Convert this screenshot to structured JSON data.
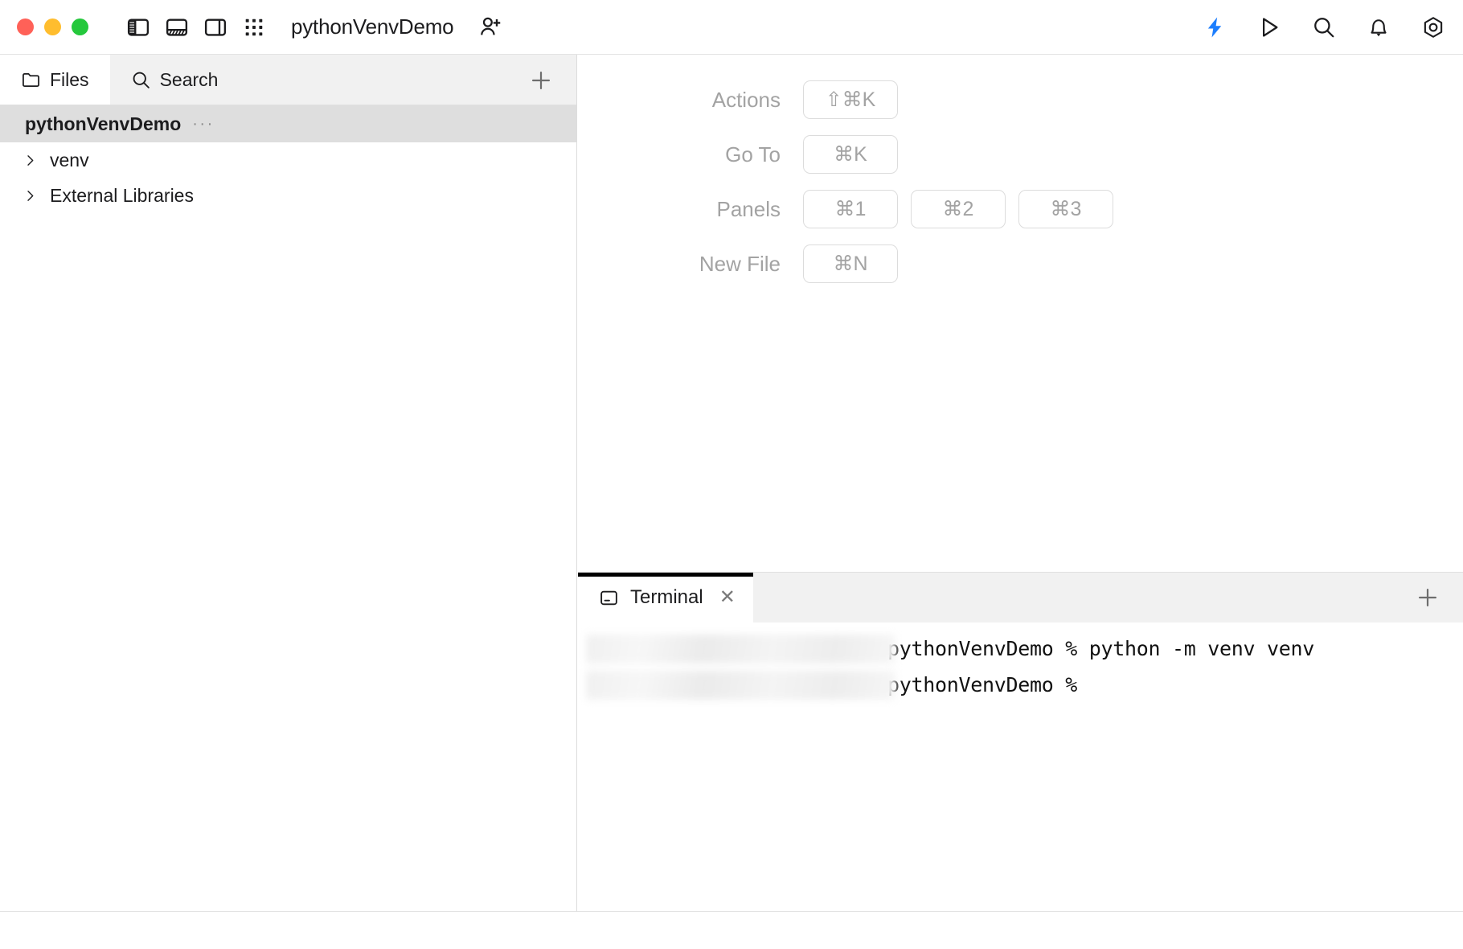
{
  "window": {
    "title": "pythonVenvDemo",
    "traffic_lights": [
      {
        "name": "close",
        "color": "#ff6158"
      },
      {
        "name": "minimize",
        "color": "#ffbd2e"
      },
      {
        "name": "maximize",
        "color": "#25c83c"
      }
    ]
  },
  "toolbar": {
    "left_icons": [
      {
        "name": "toggle-left-panel-icon",
        "label": "Toggle Left Panel"
      },
      {
        "name": "toggle-bottom-panel-icon",
        "label": "Toggle Bottom Panel"
      },
      {
        "name": "toggle-right-panel-icon",
        "label": "Toggle Right Panel"
      },
      {
        "name": "apps-grid-icon",
        "label": "Apps"
      }
    ],
    "share_icon": "add-person-icon",
    "right_icons": [
      {
        "name": "lightning-icon",
        "label": "Assistant",
        "color": "#1d7efd"
      },
      {
        "name": "run-icon",
        "label": "Run"
      },
      {
        "name": "search-icon",
        "label": "Search"
      },
      {
        "name": "bell-icon",
        "label": "Notifications"
      },
      {
        "name": "settings-icon",
        "label": "Settings"
      }
    ]
  },
  "sidebar": {
    "tabs": [
      {
        "label": "Files",
        "icon": "folder-icon",
        "active": true
      },
      {
        "label": "Search",
        "icon": "search-icon",
        "active": false
      }
    ],
    "add_label": "+",
    "tree": [
      {
        "label": "pythonVenvDemo",
        "type": "project",
        "selected": true,
        "menu": "···"
      },
      {
        "label": "venv",
        "type": "folder",
        "expanded": false
      },
      {
        "label": "External Libraries",
        "type": "folder",
        "expanded": false
      }
    ]
  },
  "editor": {
    "shortcuts": [
      {
        "label": "Actions",
        "keys": [
          "⇧⌘K"
        ]
      },
      {
        "label": "Go To",
        "keys": [
          "⌘K"
        ]
      },
      {
        "label": "Panels",
        "keys": [
          "⌘1",
          "⌘2",
          "⌘3"
        ]
      },
      {
        "label": "New File",
        "keys": [
          "⌘N"
        ]
      }
    ]
  },
  "terminal": {
    "tabs": [
      {
        "label": "Terminal",
        "icon": "terminal-icon",
        "active": true,
        "close": "✕"
      }
    ],
    "add_label": "+",
    "lines": [
      {
        "redacted": true,
        "text": "pythonVenvDemo % python -m venv venv"
      },
      {
        "redacted": true,
        "text": "pythonVenvDemo %"
      }
    ]
  }
}
